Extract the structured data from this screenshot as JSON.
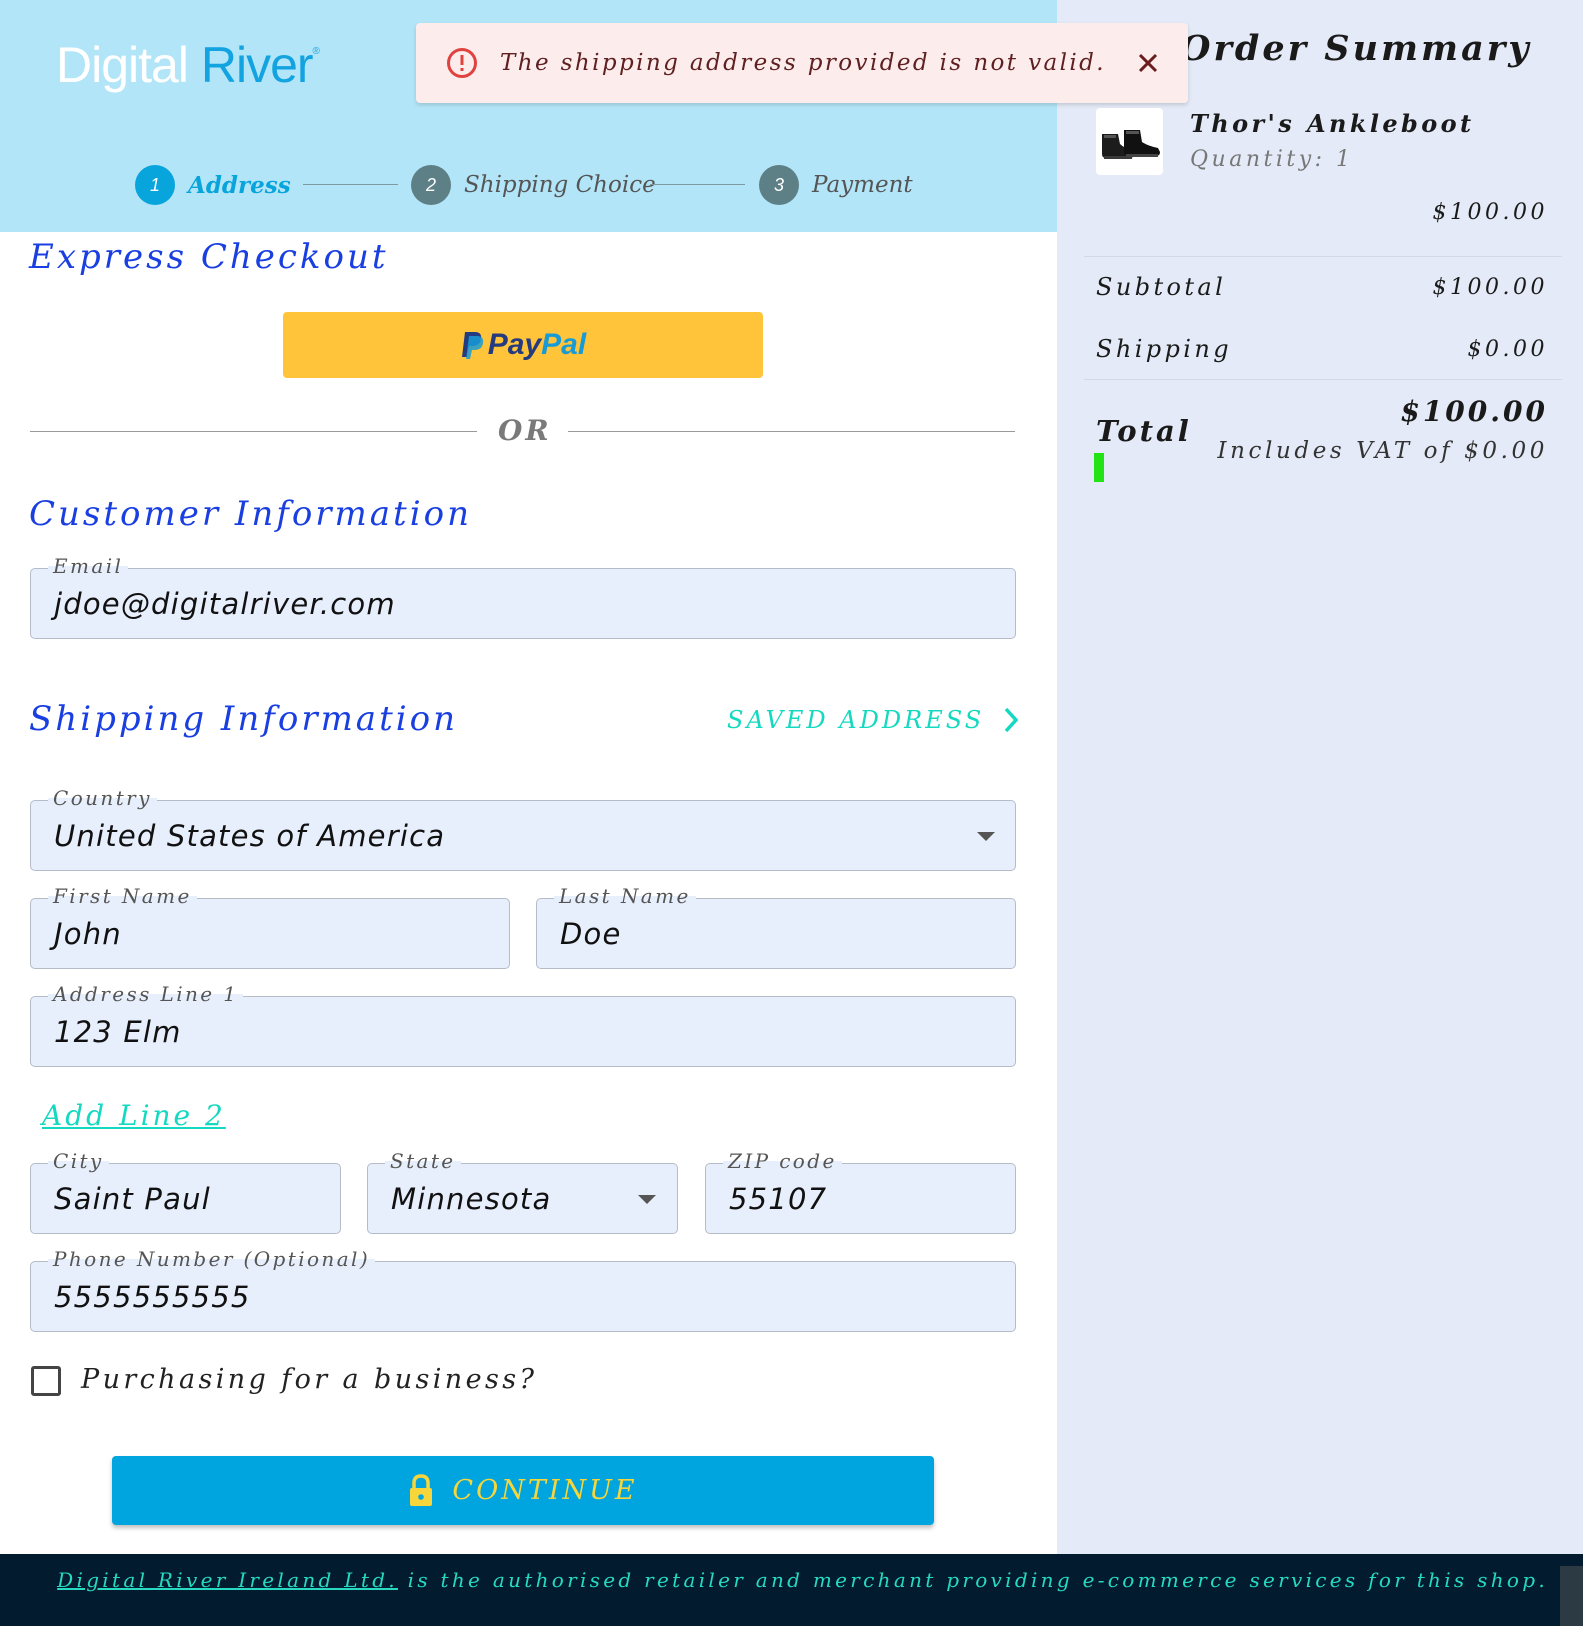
{
  "header": {
    "logo_part1": "Digital",
    "logo_part2": "River",
    "logo_mark": "®",
    "steps": [
      {
        "number": "1",
        "label": "Address",
        "state": "active"
      },
      {
        "number": "2",
        "label": "Shipping Choice",
        "state": "inactive"
      },
      {
        "number": "3",
        "label": "Payment",
        "state": "inactive"
      }
    ]
  },
  "error_banner": {
    "message": "The shipping address provided is not valid.",
    "icon": "error-circle-icon",
    "close_icon": "close-icon"
  },
  "express_checkout": {
    "title": "Express Checkout",
    "paypal_pay": "Pay",
    "paypal_pal": "Pal",
    "or_text": "OR"
  },
  "customer_info": {
    "title": "Customer Information",
    "email_label": "Email",
    "email_value": "jdoe@digitalriver.com"
  },
  "shipping_info": {
    "title": "Shipping Information",
    "saved_address": "SAVED ADDRESS",
    "country_label": "Country",
    "country_value": "United States of America",
    "first_name_label": "First Name",
    "first_name_value": "John",
    "last_name_label": "Last Name",
    "last_name_value": "Doe",
    "address1_label": "Address Line 1",
    "address1_value": "123 Elm",
    "add_line2": "Add Line 2",
    "city_label": "City",
    "city_value": "Saint Paul",
    "state_label": "State",
    "state_value": "Minnesota",
    "zip_label": "ZIP code",
    "zip_value": "55107",
    "phone_label": "Phone Number (Optional)",
    "phone_value": "5555555555",
    "business_label": "Purchasing for a business?",
    "business_checked": false
  },
  "continue_button": {
    "label": "CONTINUE",
    "icon": "lock-icon"
  },
  "order_summary": {
    "title": "Order Summary",
    "product_name": "Thor's Ankleboot",
    "product_quantity": "Quantity: 1",
    "product_price": "$100.00",
    "subtotal_label": "Subtotal",
    "subtotal_value": "$100.00",
    "shipping_label": "Shipping",
    "shipping_value": "$0.00",
    "total_label": "Total",
    "total_value": "$100.00",
    "vat_text": "Includes VAT of $0.00"
  },
  "footer": {
    "link_text": "Digital River Ireland Ltd.",
    "text": " is the authorised retailer and merchant providing e-commerce services for this shop."
  },
  "colors": {
    "header_bg": "#b3e5f8",
    "accent_blue": "#08a4dc",
    "title_blue": "#1a3fe0",
    "link_teal": "#14d9c0",
    "error_bg": "#fdecec",
    "sidebar_bg": "#e4eaf7",
    "footer_bg": "#021b2f",
    "paypal_yellow": "#ffc439"
  }
}
